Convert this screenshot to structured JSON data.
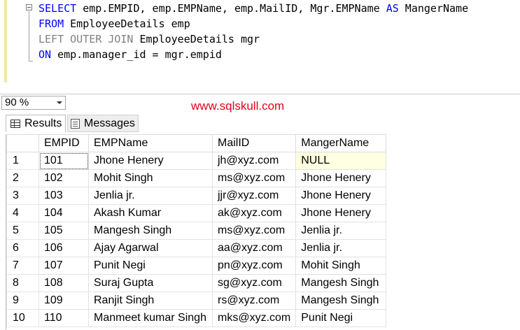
{
  "editor": {
    "lines": [
      [
        {
          "t": "SELECT",
          "c": "kw"
        },
        {
          "t": " emp.EMPID, emp.EMPName, emp.MailID, Mgr.EMPName ",
          "c": ""
        },
        {
          "t": "AS",
          "c": "kw"
        },
        {
          "t": " MangerName",
          "c": ""
        }
      ],
      [
        {
          "t": "FROM",
          "c": "kw"
        },
        {
          "t": " EmployeeDetails emp",
          "c": ""
        }
      ],
      [
        {
          "t": "LEFT OUTER JOIN",
          "c": "kw-gray"
        },
        {
          "t": " EmployeeDetails mgr",
          "c": ""
        }
      ],
      [
        {
          "t": "ON",
          "c": "kw"
        },
        {
          "t": " emp.manager_id = mgr.empid",
          "c": ""
        }
      ]
    ]
  },
  "zoom": {
    "value": "90 %"
  },
  "watermark": "www.sqlskull.com",
  "tabs": {
    "results": "Results",
    "messages": "Messages"
  },
  "grid": {
    "columns": [
      "EMPID",
      "EMPName",
      "MailID",
      "MangerName"
    ],
    "rows": [
      [
        "1",
        "101",
        "Jhone Henery",
        "jh@xyz.com",
        "NULL"
      ],
      [
        "2",
        "102",
        "Mohit Singh",
        "ms@xyz.com",
        "Jhone Henery"
      ],
      [
        "3",
        "103",
        "Jenlia jr.",
        "jjr@xyz.com",
        "Jhone Henery"
      ],
      [
        "4",
        "104",
        "Akash Kumar",
        "ak@xyz.com",
        "Jhone Henery"
      ],
      [
        "5",
        "105",
        "Mangesh Singh",
        "ms@xyz.com",
        "Jenlia jr."
      ],
      [
        "6",
        "106",
        "Ajay Agarwal",
        "aa@xyz.com",
        "Jenlia jr."
      ],
      [
        "7",
        "107",
        "Punit Negi",
        "pn@xyz.com",
        "Mohit Singh"
      ],
      [
        "8",
        "108",
        "Suraj Gupta",
        "sg@xyz.com",
        "Mangesh Singh"
      ],
      [
        "9",
        "109",
        "Ranjit Singh",
        "rs@xyz.com",
        "Mangesh Singh"
      ],
      [
        "10",
        "110",
        "Manmeet kumar Singh",
        "mks@xyz.com",
        "Punit Negi"
      ]
    ]
  }
}
